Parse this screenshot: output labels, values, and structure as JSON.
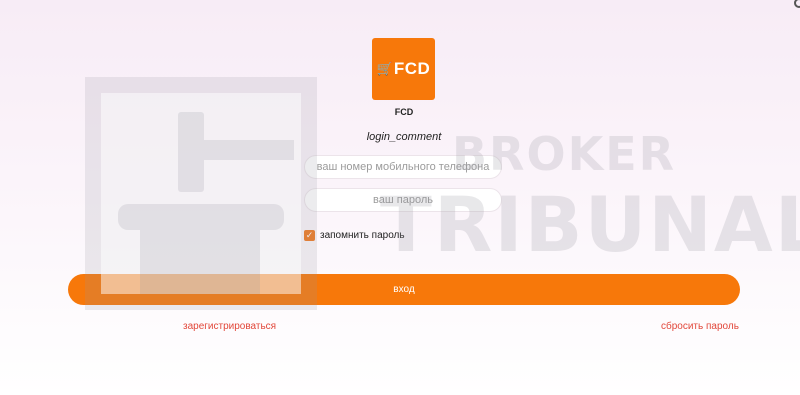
{
  "logo": {
    "text": "FCD",
    "icon": "cart-icon",
    "color": "#f7780a"
  },
  "app_name": "FCD",
  "login_comment": "login_comment",
  "form": {
    "phone_placeholder": "ваш номер мобильного телефона",
    "phone_value": "",
    "password_placeholder": "ваш пароль",
    "password_value": "",
    "remember_label": "запомнить пароль",
    "remember_checked": true,
    "login_button": "вход"
  },
  "links": {
    "register": "зарегистрироваться",
    "reset_password": "сбросить пароль",
    "link_color": "#e2473a"
  },
  "watermark": {
    "line1": "BROKER",
    "line2": "TRIBUNAL"
  },
  "colors": {
    "accent": "#f7780a",
    "background_top": "#f7ecf6"
  }
}
